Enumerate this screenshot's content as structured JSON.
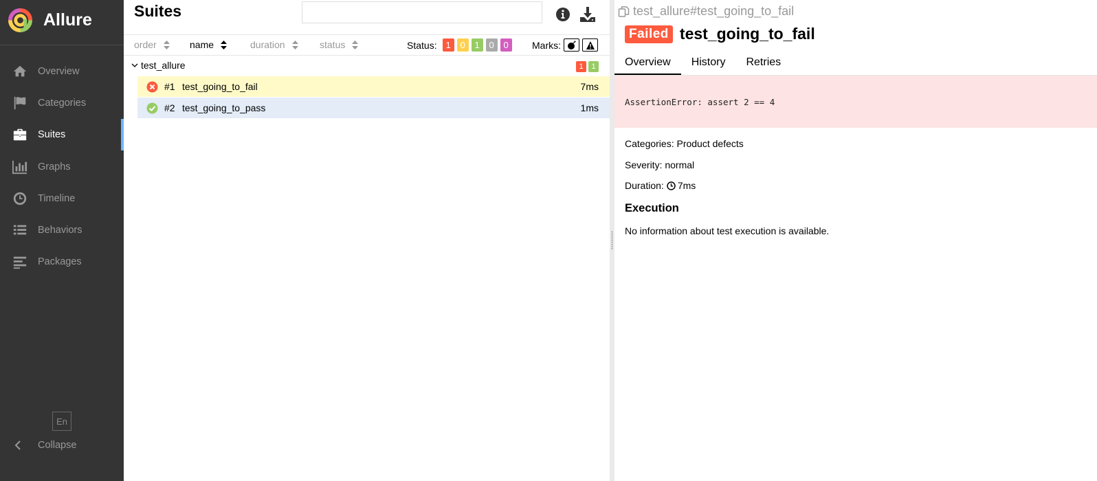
{
  "app": {
    "name": "Allure",
    "accent": "#6eb6ff",
    "sidebar_bg": "#343434"
  },
  "sidebar": {
    "items": [
      {
        "label": "Overview",
        "icon": "home-icon"
      },
      {
        "label": "Categories",
        "icon": "flag-icon"
      },
      {
        "label": "Suites",
        "icon": "briefcase-icon",
        "active": true
      },
      {
        "label": "Graphs",
        "icon": "bar-chart-icon"
      },
      {
        "label": "Timeline",
        "icon": "clock-icon"
      },
      {
        "label": "Behaviors",
        "icon": "list-icon"
      },
      {
        "label": "Packages",
        "icon": "align-left-icon"
      }
    ],
    "language": "En",
    "collapse_label": "Collapse"
  },
  "suites": {
    "title": "Suites",
    "search": {
      "value": "",
      "placeholder": ""
    },
    "sort_columns": [
      {
        "label": "order"
      },
      {
        "label": "name",
        "active": true
      },
      {
        "label": "duration"
      },
      {
        "label": "status"
      }
    ],
    "status_filter": {
      "label": "Status:",
      "counts": [
        {
          "value": "1",
          "status": "failed",
          "color": "#fd5a3e"
        },
        {
          "value": "0",
          "status": "broken",
          "color": "#ffd050"
        },
        {
          "value": "1",
          "status": "passed",
          "color": "#97cc64"
        },
        {
          "value": "0",
          "status": "skipped",
          "color": "#aaaaaa"
        },
        {
          "value": "0",
          "status": "unknown",
          "color": "#d35ebe"
        }
      ]
    },
    "marks": {
      "label": "Marks:",
      "items": [
        "flaky-icon",
        "warning-icon"
      ]
    },
    "groups": [
      {
        "name": "test_allure",
        "counts": [
          {
            "value": "1",
            "color": "#fd5a3e"
          },
          {
            "value": "1",
            "color": "#97cc64"
          }
        ],
        "tests": [
          {
            "num": "#1",
            "name": "test_going_to_fail",
            "duration": "7ms",
            "status": "failed",
            "icon": "failed-circle-icon"
          },
          {
            "num": "#2",
            "name": "test_going_to_pass",
            "duration": "1ms",
            "status": "passed",
            "icon": "passed-circle-icon"
          }
        ]
      }
    ]
  },
  "detail": {
    "breadcrumb": "test_allure#test_going_to_fail",
    "status_label": "Failed",
    "title": "test_going_to_fail",
    "tabs": [
      {
        "label": "Overview",
        "active": true
      },
      {
        "label": "History"
      },
      {
        "label": "Retries"
      }
    ],
    "error_message": "AssertionError: assert 2 == 4",
    "categories_label": "Categories:",
    "categories_value": "Product defects",
    "severity_label": "Severity:",
    "severity_value": "normal",
    "duration_label": "Duration:",
    "duration_value": "7ms",
    "execution_heading": "Execution",
    "execution_text": "No information about test execution is available."
  }
}
